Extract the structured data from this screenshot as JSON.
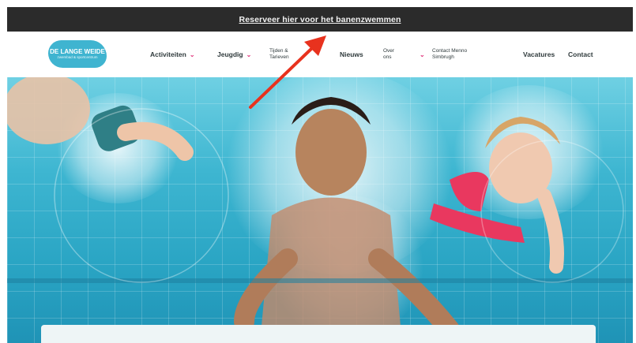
{
  "announcement": {
    "text": "Reserveer hier voor het banenzwemmen"
  },
  "logo": {
    "line1": "DE LANGE WEIDE",
    "line2": "zwembad & sportcentrum"
  },
  "nav": {
    "activiteiten": "Activiteiten",
    "jeugd": "Jeugdig",
    "tijden_line1": "Tijden &",
    "tijden_line2": "Tarieven",
    "nieuws": "Nieuws",
    "over_line1": "Over",
    "over_line2": "ons",
    "contact_line1": "Contact Menno",
    "contact_line2": "Simbrugh",
    "vacatures": "Vacatures",
    "contact": "Contact"
  },
  "colors": {
    "accent": "#e0327a",
    "brand": "#3fb4d0",
    "annotation_arrow": "#e8321e"
  },
  "hero": {
    "image": "children swimming underwater in pool"
  }
}
